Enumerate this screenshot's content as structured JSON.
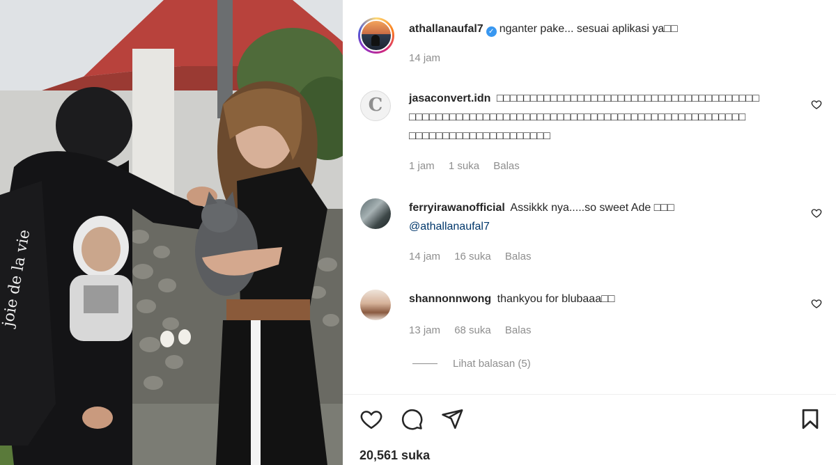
{
  "post": {
    "author": "athallanaufal7",
    "caption": "nganter pake... sesuai aplikasi ya□□",
    "time": "14 jam",
    "likes": "20,561 suka"
  },
  "comments": [
    {
      "username": "jasaconvert.idn",
      "text_lines": [
        "□□□□□□□□□□□□□□□□□□□□□□□□□□□□□□□□□□□□□□□",
        "□□□□□□□□□□□□□□□□□□□□□□□□□□□□□□□□□□□□□□□□□□□□□□□□□□",
        "□□□□□□□□□□□□□□□□□□□□□"
      ],
      "time": "1 jam",
      "likes": "1 suka",
      "reply": "Balas"
    },
    {
      "username": "ferryirawanofficial",
      "text": "Assikkk nya.....so sweet Ade □□□",
      "mention": "@athallanaufal7",
      "time": "14 jam",
      "likes": "16 suka",
      "reply": "Balas"
    },
    {
      "username": "shannonnwong",
      "text": "thankyou for blubaaa□□",
      "time": "13 jam",
      "likes": "68 suka",
      "reply": "Balas"
    }
  ],
  "view_replies": "Lihat balasan (5)",
  "icons": {
    "like": "heart-icon",
    "comment": "comment-icon",
    "share": "send-icon",
    "save": "bookmark-icon",
    "comment_like": "heart-icon",
    "verified": "verified-badge-icon"
  },
  "colors": {
    "text": "#262626",
    "muted": "#8e8e8e",
    "link": "#00376b",
    "verified": "#3897f0"
  }
}
